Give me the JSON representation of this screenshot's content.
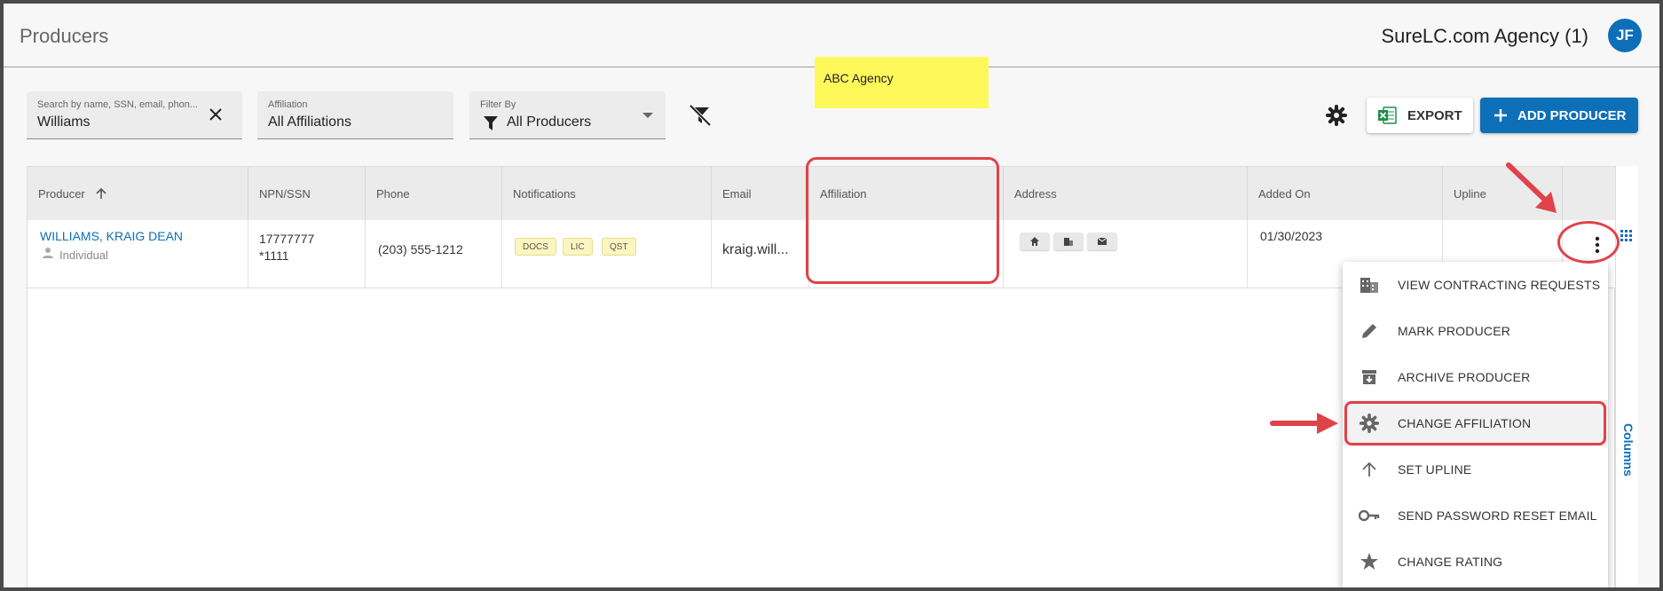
{
  "header": {
    "title": "Producers",
    "agency": "SureLC.com Agency (1)",
    "avatar_initials": "JF"
  },
  "filters": {
    "search": {
      "label": "Search by name, SSN, email, phon...",
      "value": "Williams"
    },
    "affiliation": {
      "label": "Affiliation",
      "value": "All Affiliations"
    },
    "filter_by": {
      "label": "Filter By",
      "value": "All Producers"
    }
  },
  "toolbar": {
    "export_label": "EXPORT",
    "add_label": "ADD PRODUCER"
  },
  "table": {
    "columns": [
      "Producer",
      "NPN/SSN",
      "Phone",
      "Notifications",
      "Email",
      "Affiliation",
      "Address",
      "Added On",
      "Upline"
    ],
    "rows": [
      {
        "producer": "WILLIAMS, KRAIG DEAN",
        "type": "Individual",
        "npn": "17777777",
        "ssn": "*1111",
        "phone": "(203) 555-1212",
        "notifications": [
          "DOCS",
          "LIC",
          "QST"
        ],
        "email": "kraig.will...",
        "affiliation": "ABC Agency",
        "added_on": "01/30/2023",
        "upline": ""
      }
    ]
  },
  "columns_panel": {
    "label": "Columns"
  },
  "menu": {
    "items": [
      {
        "label": "VIEW CONTRACTING REQUESTS",
        "icon": "building-icon"
      },
      {
        "label": "MARK PRODUCER",
        "icon": "pencil-icon"
      },
      {
        "label": "ARCHIVE PRODUCER",
        "icon": "archive-icon"
      },
      {
        "label": "CHANGE AFFILIATION",
        "icon": "gear-icon"
      },
      {
        "label": "SET UPLINE",
        "icon": "arrow-up-icon"
      },
      {
        "label": "SEND PASSWORD RESET EMAIL",
        "icon": "key-icon"
      },
      {
        "label": "CHANGE RATING",
        "icon": "star-icon"
      }
    ]
  },
  "colors": {
    "accent": "#0d6fb8",
    "highlight": "#fff85a",
    "annotation": "#e0424a"
  }
}
